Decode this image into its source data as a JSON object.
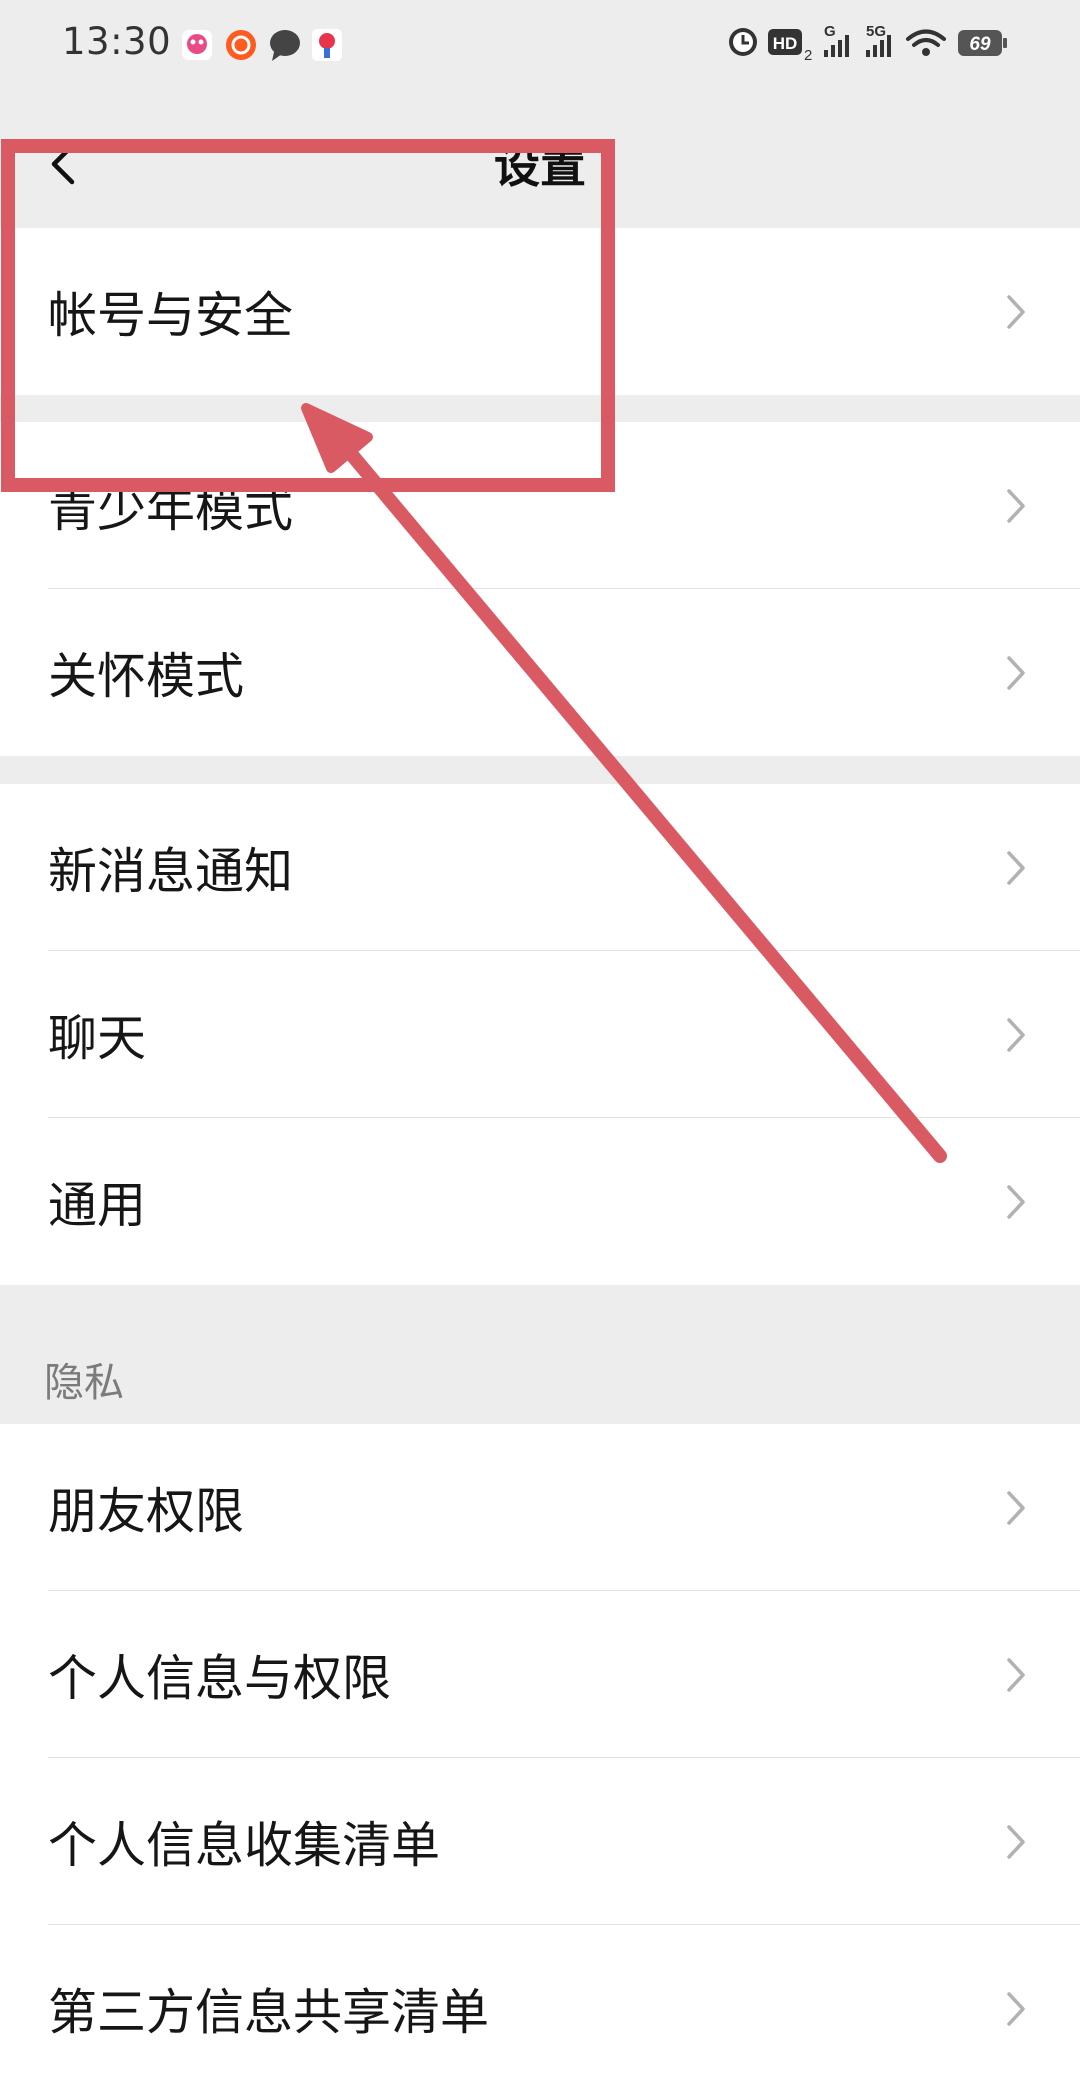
{
  "status_bar": {
    "time": "13:30",
    "network_labels": [
      "HD",
      "2",
      "G",
      "5G"
    ],
    "battery": "69",
    "notification_icons": [
      "soul-app-icon",
      "taobao-app-icon",
      "message-icon",
      "map-pin-app-icon"
    ]
  },
  "header": {
    "title": "设置",
    "back_icon": "chevron-left-icon"
  },
  "groups": [
    {
      "items": [
        {
          "label": "帐号与安全"
        }
      ]
    },
    {
      "items": [
        {
          "label": "青少年模式"
        },
        {
          "label": "关怀模式"
        }
      ]
    },
    {
      "items": [
        {
          "label": "新消息通知"
        },
        {
          "label": "聊天"
        },
        {
          "label": "通用"
        }
      ]
    },
    {
      "header": "隐私",
      "items": [
        {
          "label": "朋友权限"
        },
        {
          "label": "个人信息与权限"
        },
        {
          "label": "个人信息收集清单"
        },
        {
          "label": "第三方信息共享清单"
        }
      ]
    }
  ],
  "colors": {
    "background": "#ededed",
    "card": "#ffffff",
    "annotation": "#d95a63",
    "chevron": "#b2b2b2"
  }
}
